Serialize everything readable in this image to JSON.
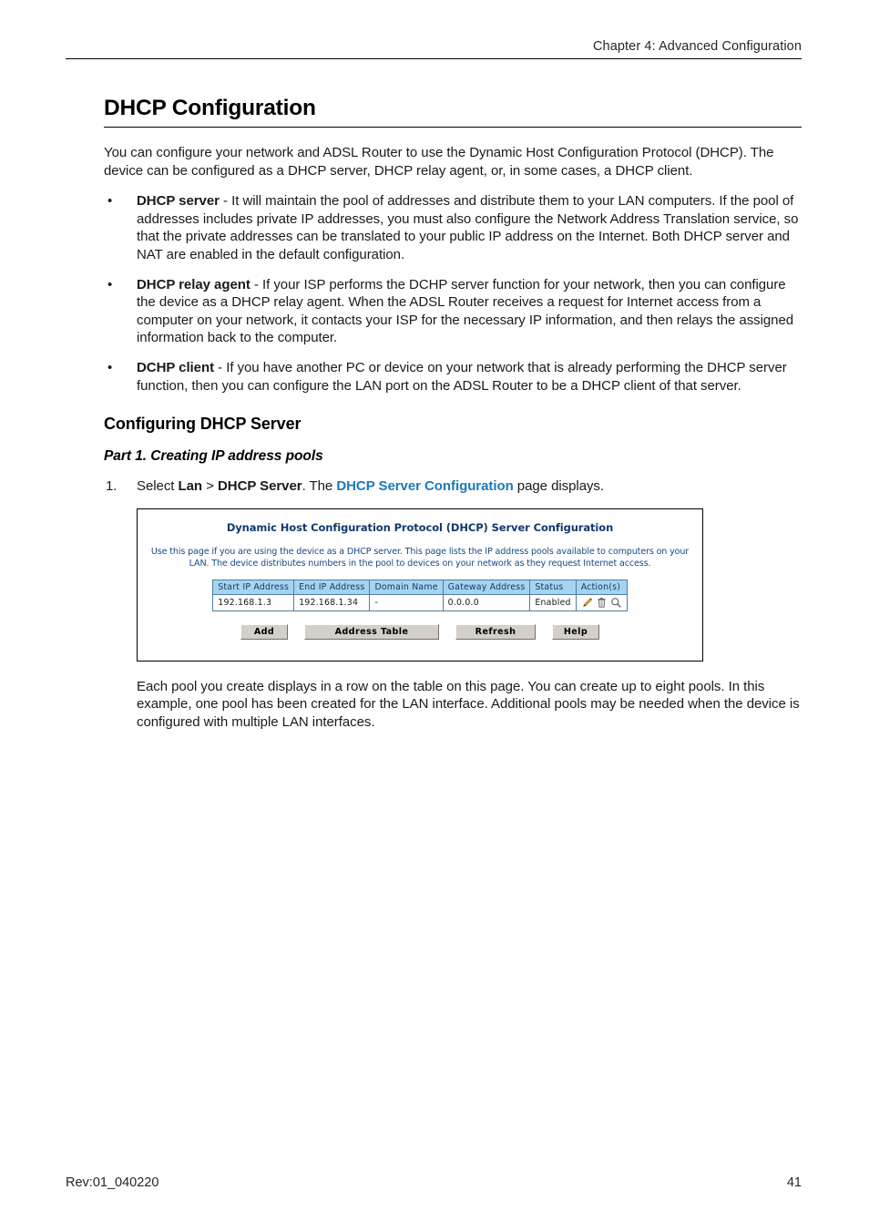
{
  "header": {
    "chapter": "Chapter 4: Advanced Configuration"
  },
  "title": "DHCP Configuration",
  "intro": "You can configure your network and ADSL Router to use the Dynamic Host Configuration Protocol (DHCP). The device can be configured as a DHCP server, DHCP relay agent, or, in some cases, a DHCP client.",
  "bullets": [
    {
      "term": "DHCP server",
      "text": " - It will maintain the pool of addresses and distribute them to your LAN computers. If the pool of addresses includes private IP addresses, you must also configure the Network Address Translation service, so that the private addresses can be translated to your public IP address on the Internet. Both DHCP server and NAT are enabled in the default configuration."
    },
    {
      "term": "DHCP relay agent",
      "text": " - If your ISP performs the DCHP server function for your network, then you can configure the device as a DHCP relay agent. When the ADSL Router receives a request for Internet access from a computer on your network, it contacts your ISP for the necessary IP information, and then relays the assigned information back to the computer."
    },
    {
      "term": "DCHP client",
      "text": " - If you have another PC or device on your network that is already performing the DHCP server function, then you can configure the LAN port on the ADSL Router to be a DHCP client of that server."
    }
  ],
  "section_heading": "Configuring DHCP Server",
  "subsection_heading": "Part 1. Creating IP address pools",
  "step": {
    "number": "1.",
    "prefix": "Select ",
    "menu1": "Lan",
    "separator": " > ",
    "menu2": "DHCP Server",
    "middle": ". The ",
    "link": "DHCP Server Configuration",
    "suffix": " page displays."
  },
  "screenshot": {
    "title": "Dynamic Host Configuration Protocol (DHCP) Server Configuration",
    "description": "Use this page if you are using the device as a DHCP server. This page lists the IP address pools available to computers on your LAN. The device distributes numbers in the pool to devices on your network as they request Internet access.",
    "table": {
      "columns": [
        "Start IP Address",
        "End IP Address",
        "Domain Name",
        "Gateway Address",
        "Status",
        "Action(s)"
      ],
      "rows": [
        {
          "start_ip": "192.168.1.3",
          "end_ip": "192.168.1.34",
          "domain_name": "-",
          "gateway_address": "0.0.0.0",
          "status": "Enabled",
          "actions": [
            "pencil-edit-icon",
            "trash-delete-icon",
            "magnifier-view-icon"
          ]
        }
      ]
    },
    "buttons": [
      {
        "label": "Add",
        "size": "small"
      },
      {
        "label": "Address Table",
        "size": "wide"
      },
      {
        "label": "Refresh",
        "size": "med"
      },
      {
        "label": "Help",
        "size": "small"
      }
    ]
  },
  "closing": "Each pool you create displays in a row on the table on this page. You can create up to eight pools. In this example, one pool has been created for the LAN interface. Additional pools may be needed when the device is configured with multiple LAN interfaces.",
  "footer": {
    "revision": "Rev:01_040220",
    "page_number": "41"
  },
  "colors": {
    "link": "#1a7ab8",
    "shot_title": "#123a6b",
    "shot_text": "#164a86",
    "table_header_bg": "#a6d4ef",
    "button_face": "#d4d0c8"
  }
}
